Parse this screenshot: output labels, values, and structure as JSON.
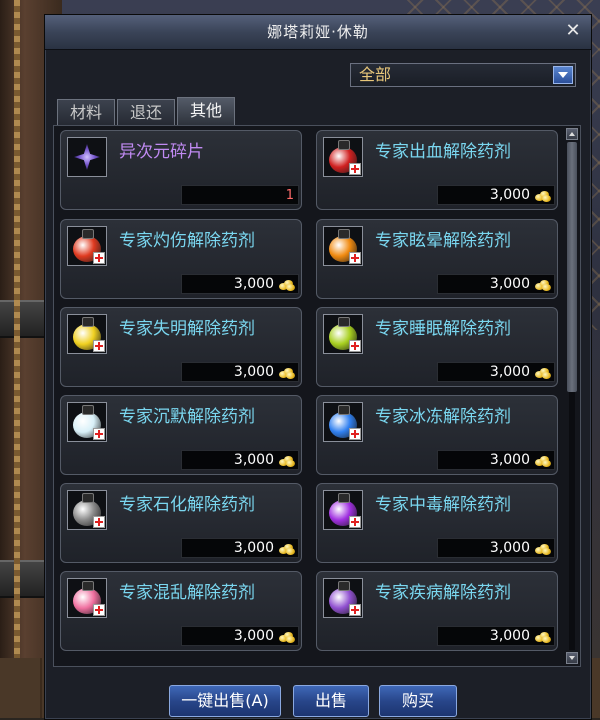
{
  "window": {
    "title": "娜塔莉娅·休勒",
    "close_icon": "close-icon"
  },
  "filter": {
    "selected": "全部",
    "icon": "chevron-down-icon"
  },
  "tabs": [
    {
      "label": "材料",
      "active": false
    },
    {
      "label": "退还",
      "active": false
    },
    {
      "label": "其他",
      "active": true
    }
  ],
  "items": [
    {
      "name": "异次元碎片",
      "price": "",
      "count": "1",
      "icon": "dimension-shard-icon",
      "color": "#7a5ad0",
      "name_color": "purple"
    },
    {
      "name": "专家出血解除药剂",
      "price": "3,000",
      "icon": "red-potion-icon",
      "color": "#d02020"
    },
    {
      "name": "专家灼伤解除药剂",
      "price": "3,000",
      "icon": "red-potion-icon",
      "color": "#e03a20"
    },
    {
      "name": "专家眩晕解除药剂",
      "price": "3,000",
      "icon": "orange-potion-icon",
      "color": "#f08a10"
    },
    {
      "name": "专家失明解除药剂",
      "price": "3,000",
      "icon": "yellow-potion-icon",
      "color": "#f0d020"
    },
    {
      "name": "专家睡眠解除药剂",
      "price": "3,000",
      "icon": "green-yellow-potion-icon",
      "color": "#a8d020"
    },
    {
      "name": "专家沉默解除药剂",
      "price": "3,000",
      "icon": "white-potion-icon",
      "color": "#d8f0f8"
    },
    {
      "name": "专家冰冻解除药剂",
      "price": "3,000",
      "icon": "blue-potion-icon",
      "color": "#3080f0"
    },
    {
      "name": "专家石化解除药剂",
      "price": "3,000",
      "icon": "gray-potion-icon",
      "color": "#8a8a8a"
    },
    {
      "name": "专家中毒解除药剂",
      "price": "3,000",
      "icon": "purple-potion-icon",
      "color": "#a030e0"
    },
    {
      "name": "专家混乱解除药剂",
      "price": "3,000",
      "icon": "rainbow-potion-icon",
      "color": "#f070a0"
    },
    {
      "name": "专家疾病解除药剂",
      "price": "3,000",
      "icon": "purple-green-potion-icon",
      "color": "#9050d0"
    }
  ],
  "buttons": {
    "sell_all": "一键出售(A)",
    "sell": "出售",
    "buy": "购买"
  },
  "colors": {
    "accent": "#2b4f9a",
    "item_name": "#7ad7f0",
    "highlight_name": "#c08af2",
    "price_text": "#ffffff"
  }
}
